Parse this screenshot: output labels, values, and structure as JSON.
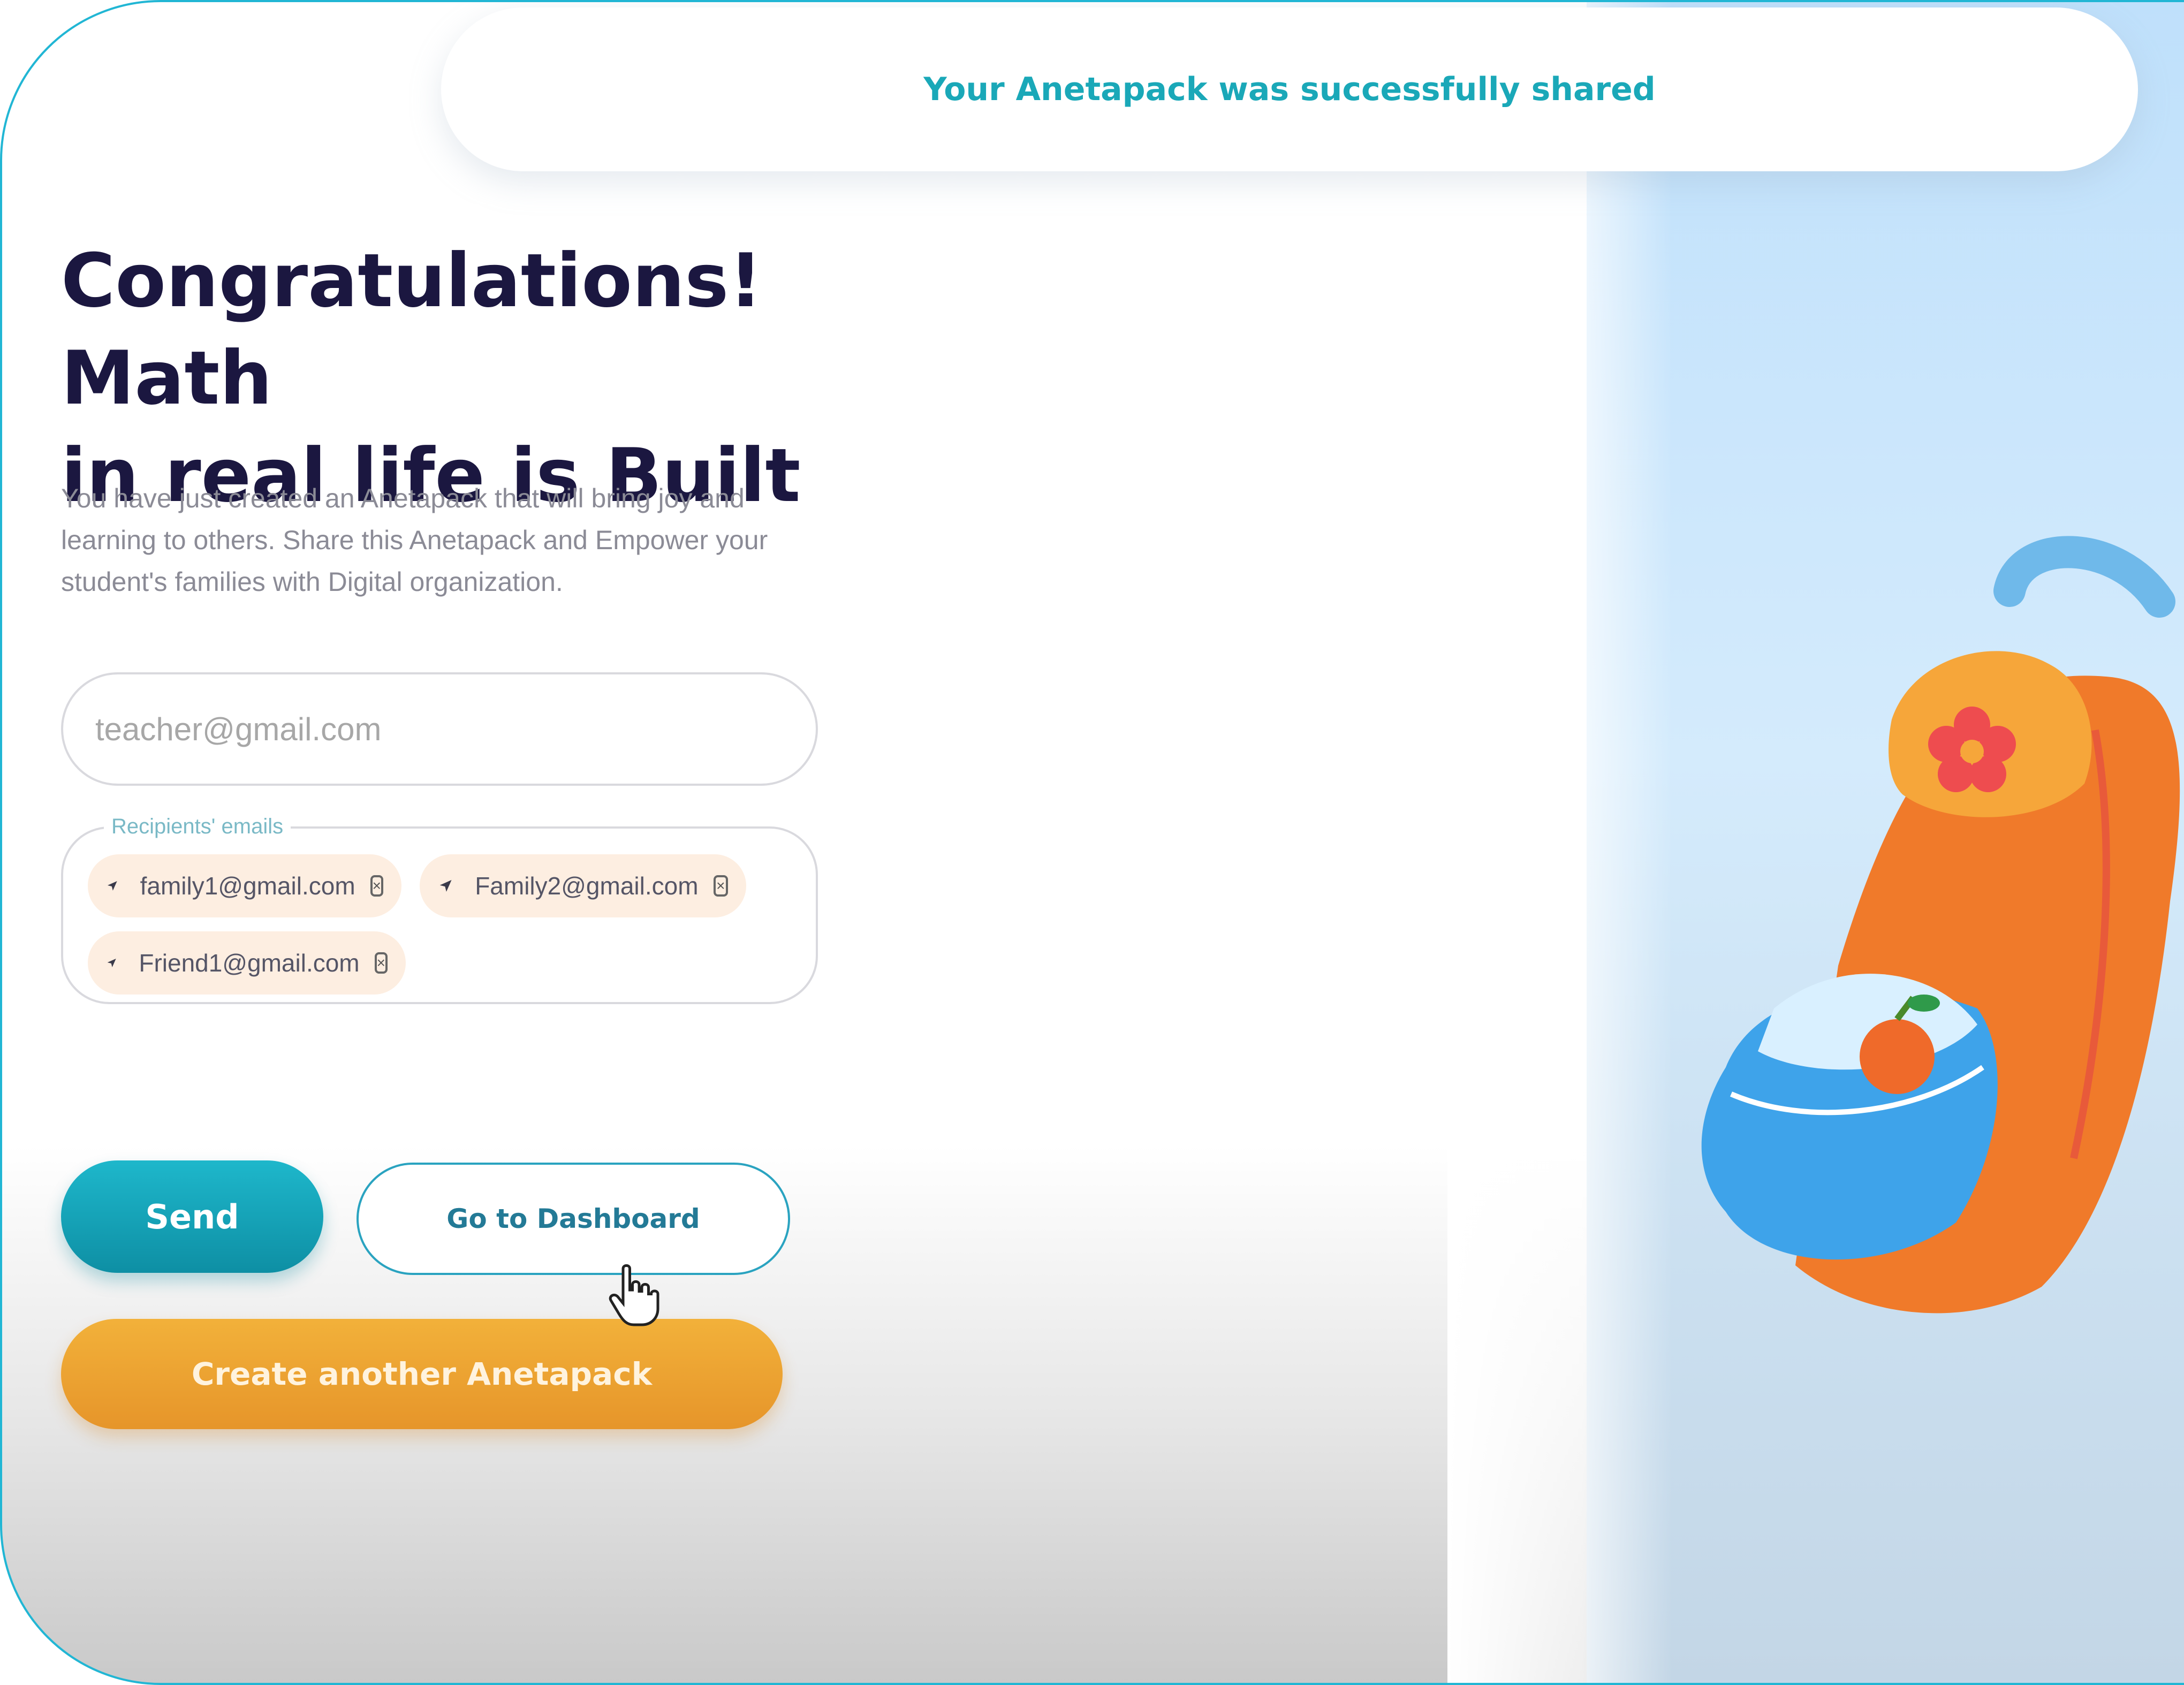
{
  "toast": {
    "message": "Your Anetapack was successfully shared"
  },
  "heading": {
    "line1": "Congratulations! Math",
    "line2": "in real life is Built"
  },
  "description": "You have just created an Anetapack that will bring joy and learning to others. Share this Anetapack and Empower your student's families with Digital organization.",
  "sender_field": {
    "placeholder": "teacher@gmail.com"
  },
  "recipients": {
    "label": "Recipients' emails",
    "chips": [
      {
        "email": "family1@gmail.com",
        "icon": "send-icon"
      },
      {
        "email": "Family2@gmail.com",
        "icon": "send-icon"
      },
      {
        "email": "Friend1@gmail.com",
        "icon": "send-icon"
      }
    ]
  },
  "buttons": {
    "send": "Send",
    "dashboard": "Go to Dashboard",
    "create_another": "Create another Anetapack"
  },
  "colors": {
    "accent_teal": "#1aa8b8",
    "accent_orange": "#e6952a",
    "chip_bg": "#fdeee1",
    "heading": "#1b1740"
  }
}
